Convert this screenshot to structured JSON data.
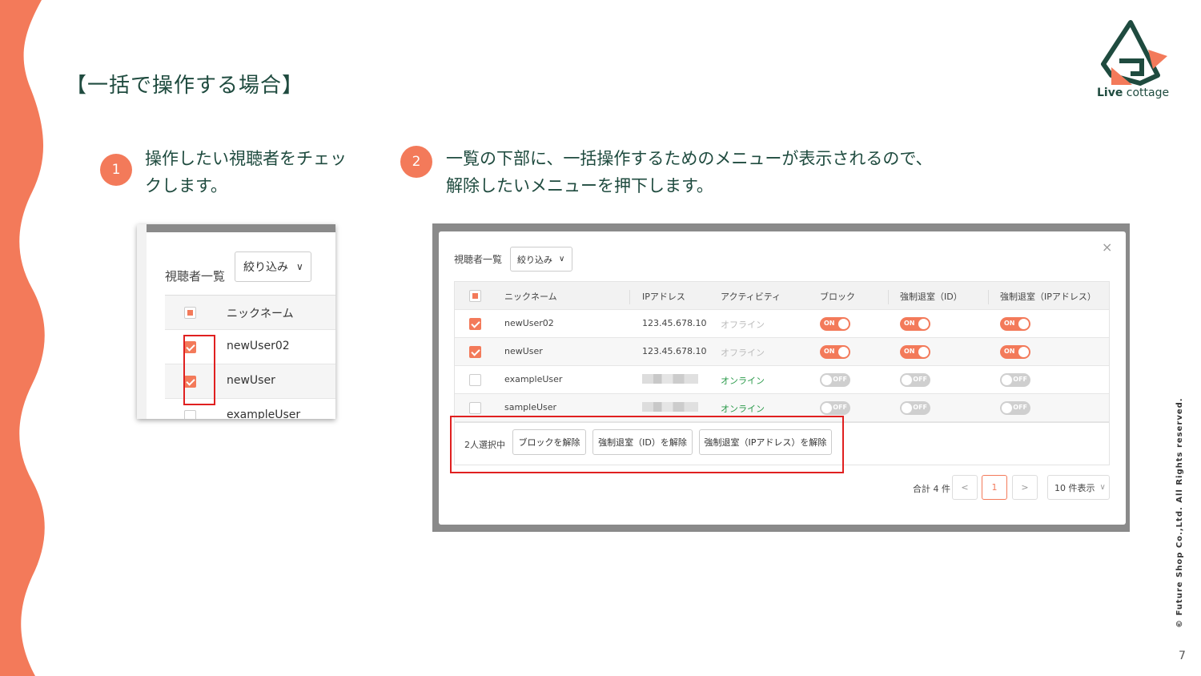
{
  "slide": {
    "title": "【一括で操作する場合】",
    "page_number": "7",
    "copyright": "© Future Shop Co.,Ltd. All Rights reserved.",
    "accent_color": "#f37a5a",
    "title_color": "#1f4b3f"
  },
  "logo": {
    "bold": "Live",
    "rest": " cottage"
  },
  "steps": [
    {
      "num": "1",
      "text_lines": [
        "操作したい視聴者をチェッ",
        "クします。"
      ]
    },
    {
      "num": "2",
      "text_lines": [
        "一覧の下部に、一括操作するためのメニューが表示されるので、",
        "解除したいメニューを押下します。"
      ]
    }
  ],
  "shot1": {
    "label": "視聴者一覧",
    "filter": "絞り込み",
    "header": "ニックネーム",
    "rows": [
      {
        "name": "newUser02",
        "checked": true
      },
      {
        "name": "newUser",
        "checked": true
      },
      {
        "name": "exampleUser",
        "checked": false
      }
    ]
  },
  "shot2": {
    "label": "視聴者一覧",
    "filter": "絞り込み",
    "close": "×",
    "headers": [
      "ニックネーム",
      "IPアドレス",
      "アクティビティ",
      "ブロック",
      "強制退室（ID）",
      "強制退室（IPアドレス）"
    ],
    "rows": [
      {
        "nick": "newUser02",
        "ip": "123.45.678.10",
        "activity": "オフライン",
        "block": "ON",
        "id": "ON",
        "ipa": "ON"
      },
      {
        "nick": "newUser",
        "ip": "123.45.678.10",
        "activity": "オフライン",
        "block": "ON",
        "id": "ON",
        "ipa": "ON"
      },
      {
        "nick": "exampleUser",
        "ip": "",
        "activity": "オンライン",
        "block": "OFF",
        "id": "OFF",
        "ipa": "OFF"
      },
      {
        "nick": "sampleUser",
        "ip": "",
        "activity": "オンライン",
        "block": "OFF",
        "id": "OFF",
        "ipa": "OFF"
      }
    ],
    "bulk": {
      "count": "2人選択中",
      "btn_block": "ブロックを解除",
      "btn_id": "強制退室（ID）を解除",
      "btn_ip": "強制退室（IPアドレス）を解除"
    },
    "pagination": {
      "total": "合計 4 件",
      "prev": "<",
      "page": "1",
      "next": ">",
      "per_page": "10 件表示"
    }
  }
}
